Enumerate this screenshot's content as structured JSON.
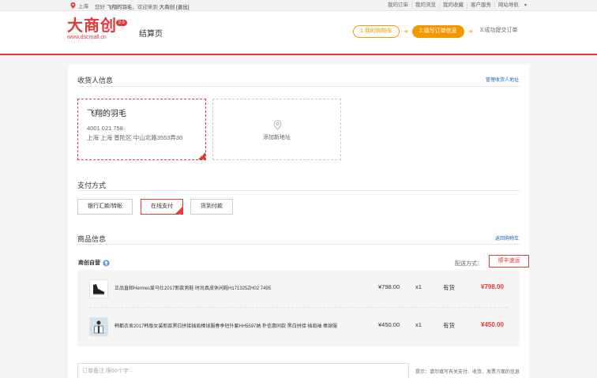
{
  "topbar": {
    "location": "上海",
    "greeting": "您好",
    "username": "飞翔的羽毛",
    "welcome": "，欢迎来到",
    "site": "大商创",
    "logout": "[退出]",
    "links": [
      "我的订单",
      "我的浏览",
      "我的收藏",
      "客户服务",
      "网站导航"
    ]
  },
  "header": {
    "logo_text": "大商创",
    "logo_version": "2.0",
    "logo_url": "www.dscmall.cn",
    "page_name": "结算页",
    "steps": [
      "1.我的购物车",
      "2.填写订单信息",
      "3.成功提交订单"
    ]
  },
  "consignee": {
    "title": "收货人信息",
    "manage_link": "管理收货人地址",
    "selected": {
      "name": "飞翔的羽毛",
      "phone": "4001 021 758",
      "address": "上海 上海 普陀区 中山北路3553弄30"
    },
    "add_new": "添加新地址"
  },
  "payment": {
    "title": "支付方式",
    "options": [
      "银行汇款/转帐",
      "在线支付",
      "货到付款"
    ],
    "selected": "在线支付"
  },
  "goods": {
    "title": "商品信息",
    "back_link": "返回购物车",
    "shop_name": "商创自营",
    "delivery_label": "配送方式：",
    "delivery_method": "顺丰速运",
    "items": [
      {
        "title": "正品直邮Hermes爱马仕2017新款男鞋 时尚真皮休闲鞋H171325ZH02 7495",
        "price": "¥798.00",
        "qty": "x1",
        "stock": "有货",
        "total": "¥798.00"
      },
      {
        "title": "韩都衣舍2017韩版女装新款黑白拼接插肩棒球服春季短外套HH5597妠 朴信惠同款 黑白拼接 插肩袖 棒球服",
        "price": "¥450.00",
        "qty": "x1",
        "stock": "有货",
        "total": "¥450.00"
      }
    ]
  },
  "remark": {
    "placeholder": "订单备注 限60个字",
    "tip": "提示：请勿填写有关支付、收货、发票方面的信息"
  },
  "colors": {
    "brand_red": "#e4393c",
    "step_orange": "#f39800",
    "link_blue": "#1a66b3"
  }
}
